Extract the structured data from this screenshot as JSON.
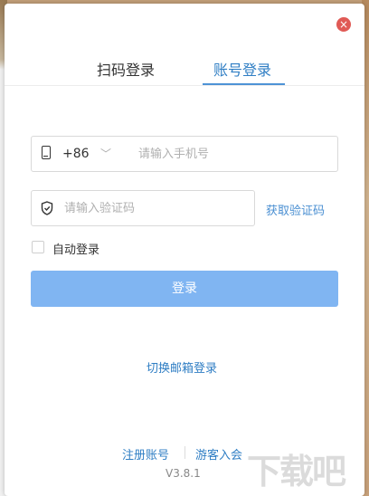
{
  "dialog": {
    "close_symbol": "×",
    "tabs": [
      {
        "label": "扫码登录",
        "active": false
      },
      {
        "label": "账号登录",
        "active": true
      }
    ],
    "phone": {
      "country_code": "+86",
      "placeholder": "请输入手机号",
      "value": ""
    },
    "code": {
      "placeholder": "请输入验证码",
      "value": "",
      "get_code_label": "获取验证码"
    },
    "auto_login": {
      "label": "自动登录",
      "checked": false
    },
    "login_button": "登录",
    "switch_email": "切换邮箱登录",
    "footer": {
      "register": "注册账号",
      "guest": "游客入会",
      "version": "V3.8.1"
    },
    "watermark": "下载吧"
  },
  "icons": {
    "close": "close-icon",
    "phone": "phone-icon",
    "chevron": "chevron-down-icon",
    "shield": "shield-icon"
  },
  "colors": {
    "accent": "#2f7ec4",
    "login_button": "#80b5f2",
    "close_button": "#e05a55"
  }
}
